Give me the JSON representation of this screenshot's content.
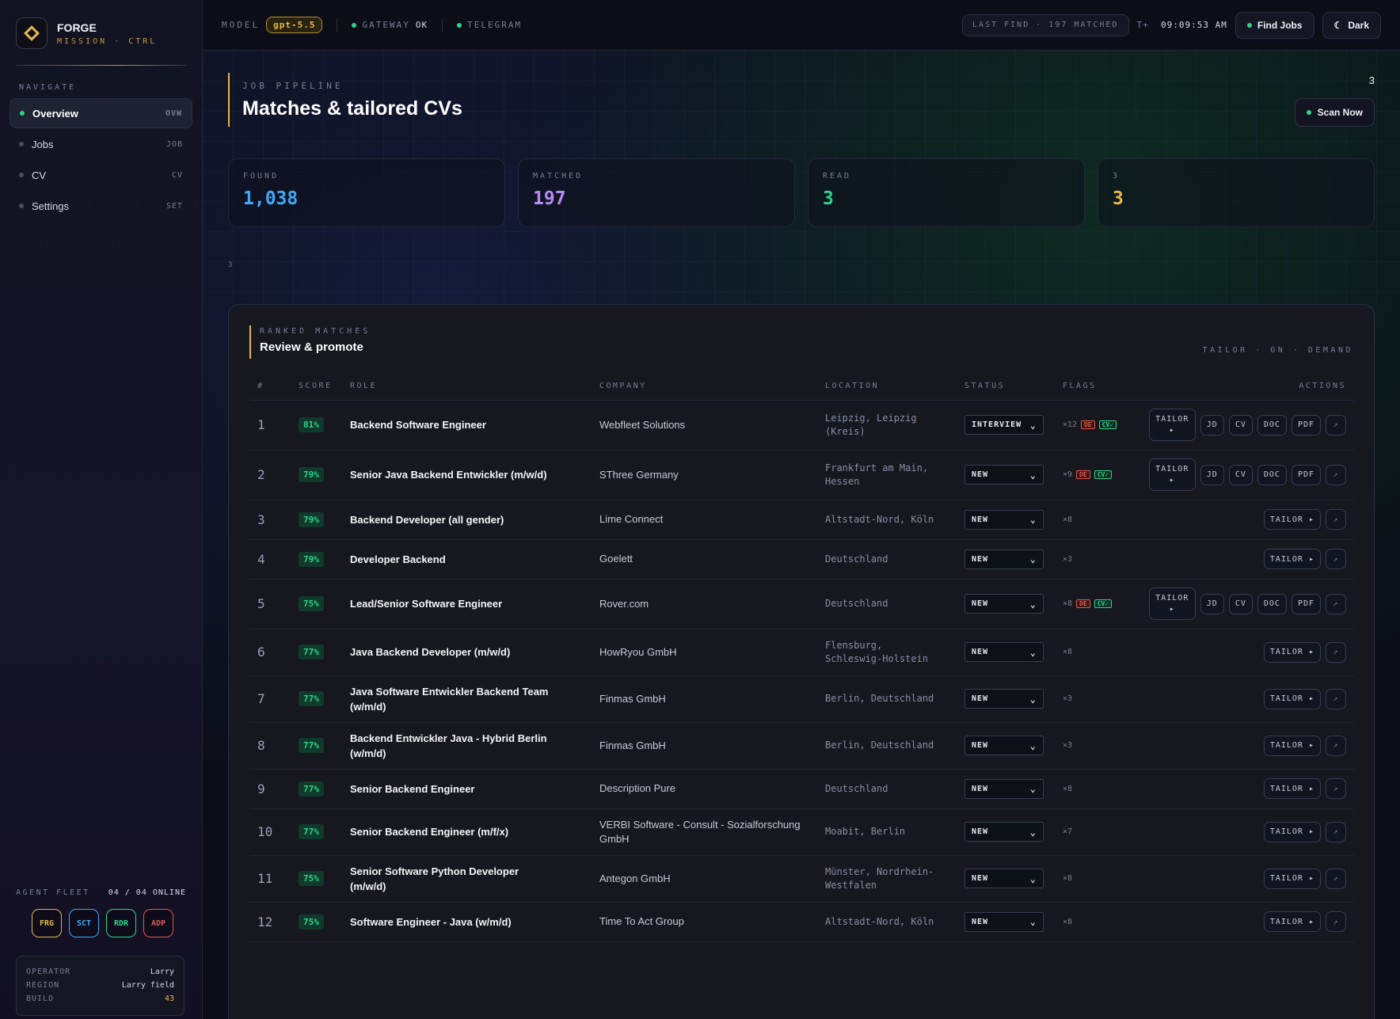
{
  "brand": {
    "name": "FORGE",
    "sub": "MISSION · CTRL"
  },
  "nav": {
    "heading": "NAVIGATE",
    "items": [
      {
        "label": "Overview",
        "code": "OVW"
      },
      {
        "label": "Jobs",
        "code": "JOB"
      },
      {
        "label": "CV",
        "code": "CV"
      },
      {
        "label": "Settings",
        "code": "SET"
      }
    ]
  },
  "fleet": {
    "heading": "AGENT FLEET",
    "online": "04 / 04 ONLINE",
    "agents": [
      {
        "code": "FRG",
        "color": "#e6b84a"
      },
      {
        "code": "SCT",
        "color": "#3fa9f5"
      },
      {
        "code": "RDR",
        "color": "#2fd38c"
      },
      {
        "code": "ADP",
        "color": "#e0594f"
      }
    ]
  },
  "operator": {
    "operator_k": "OPERATOR",
    "operator_v": "Larry",
    "region_k": "REGION",
    "region_v": "Larry field",
    "build_k": "BUILD",
    "build_v": "43"
  },
  "topbar": {
    "model_k": "MODEL",
    "model_v": "gpt-5.5",
    "gateway_k": "GATEWAY",
    "gateway_v": "OK",
    "telegram_k": "TELEGRAM",
    "last_find": "LAST FIND · 197 MATCHED",
    "clock_k": "T+",
    "clock_v": "09:09:53 AM",
    "find_jobs": "Find Jobs",
    "theme": "Dark"
  },
  "hero": {
    "kicker": "JOB PIPELINE",
    "title": "Matches & tailored CVs",
    "stray_a": "3",
    "stray_b": "3",
    "scan": "Scan Now"
  },
  "cards": [
    {
      "label": "FOUND",
      "value": "1,038",
      "color": "#3fa9f5"
    },
    {
      "label": "MATCHED",
      "value": "197",
      "color": "#b48cf2"
    },
    {
      "label": "READ",
      "value": "3",
      "color": "#2fd38c"
    },
    {
      "label": "3",
      "value": "3",
      "color": "#e6b84a"
    }
  ],
  "panel": {
    "kicker": "RANKED MATCHES",
    "title": "Review & promote",
    "tag": "TAILOR · ON · DEMAND",
    "columns": {
      "num": "#",
      "score": "SCORE",
      "role": "ROLE",
      "company": "COMPANY",
      "location": "LOCATION",
      "status": "STATUS",
      "flags": "FLAGS",
      "actions": "ACTIONS"
    }
  },
  "actions": {
    "tailor": "TAILOR",
    "arrow": "▸",
    "jd": "JD",
    "cv": "CV",
    "doc": "DOC",
    "pdf": "PDF",
    "ext": "↗"
  },
  "rows": [
    {
      "n": "1",
      "score": "81%",
      "role": "Backend Software Engineer",
      "company": "Webfleet Solutions",
      "location": "Leipzig, Leipzig (Kreis)",
      "status": "INTERVIEW",
      "flags": "×12",
      "de": "DE",
      "cv": "CV✓",
      "full": true
    },
    {
      "n": "2",
      "score": "79%",
      "role": "Senior Java Backend Entwickler (m/w/d)",
      "company": "SThree Germany",
      "location": "Frankfurt am Main, Hessen",
      "status": "NEW",
      "flags": "×9",
      "de": "DE",
      "cv": "CV✓",
      "full": true
    },
    {
      "n": "3",
      "score": "79%",
      "role": "Backend Developer (all gender)",
      "company": "Lime Connect",
      "location": "Altstadt-Nord, Köln",
      "status": "NEW",
      "flags": "×8",
      "full": false
    },
    {
      "n": "4",
      "score": "79%",
      "role": "Developer Backend",
      "company": "Goelett",
      "location": "Deutschland",
      "status": "NEW",
      "flags": "×3",
      "full": false
    },
    {
      "n": "5",
      "score": "75%",
      "role": "Lead/Senior Software Engineer",
      "company": "Rover.com",
      "location": "Deutschland",
      "status": "NEW",
      "flags": "×8",
      "de": "DE",
      "cv": "CV✓",
      "full": true
    },
    {
      "n": "6",
      "score": "77%",
      "role": "Java Backend Developer (m/w/d)",
      "company": "HowRyou GmbH",
      "location": "Flensburg, Schleswig-Holstein",
      "status": "NEW",
      "flags": "×8",
      "full": false
    },
    {
      "n": "7",
      "score": "77%",
      "role": "Java Software Entwickler Backend Team (w/m/d)",
      "company": "Finmas GmbH",
      "location": "Berlin, Deutschland",
      "status": "NEW",
      "flags": "×3",
      "full": false
    },
    {
      "n": "8",
      "score": "77%",
      "role": "Backend Entwickler Java - Hybrid Berlin (w/m/d)",
      "company": "Finmas GmbH",
      "location": "Berlin, Deutschland",
      "status": "NEW",
      "flags": "×3",
      "full": false
    },
    {
      "n": "9",
      "score": "77%",
      "role": "Senior Backend Engineer",
      "company": "Description Pure",
      "location": "Deutschland",
      "status": "NEW",
      "flags": "×8",
      "full": false
    },
    {
      "n": "10",
      "score": "77%",
      "role": "Senior Backend Engineer (m/f/x)",
      "company": "VERBI Software - Consult - Sozialforschung GmbH",
      "location": "Moabit, Berlin",
      "status": "NEW",
      "flags": "×7",
      "full": false
    },
    {
      "n": "11",
      "score": "75%",
      "role": "Senior Software Python Developer (m/w/d)",
      "company": "Antegon GmbH",
      "location": "Münster, Nordrhein-Westfalen",
      "status": "NEW",
      "flags": "×8",
      "full": false
    },
    {
      "n": "12",
      "score": "75%",
      "role": "Software Engineer - Java (w/m/d)",
      "company": "Time To Act Group",
      "location": "Altstadt-Nord, Köln",
      "status": "NEW",
      "flags": "×8",
      "full": false
    }
  ]
}
